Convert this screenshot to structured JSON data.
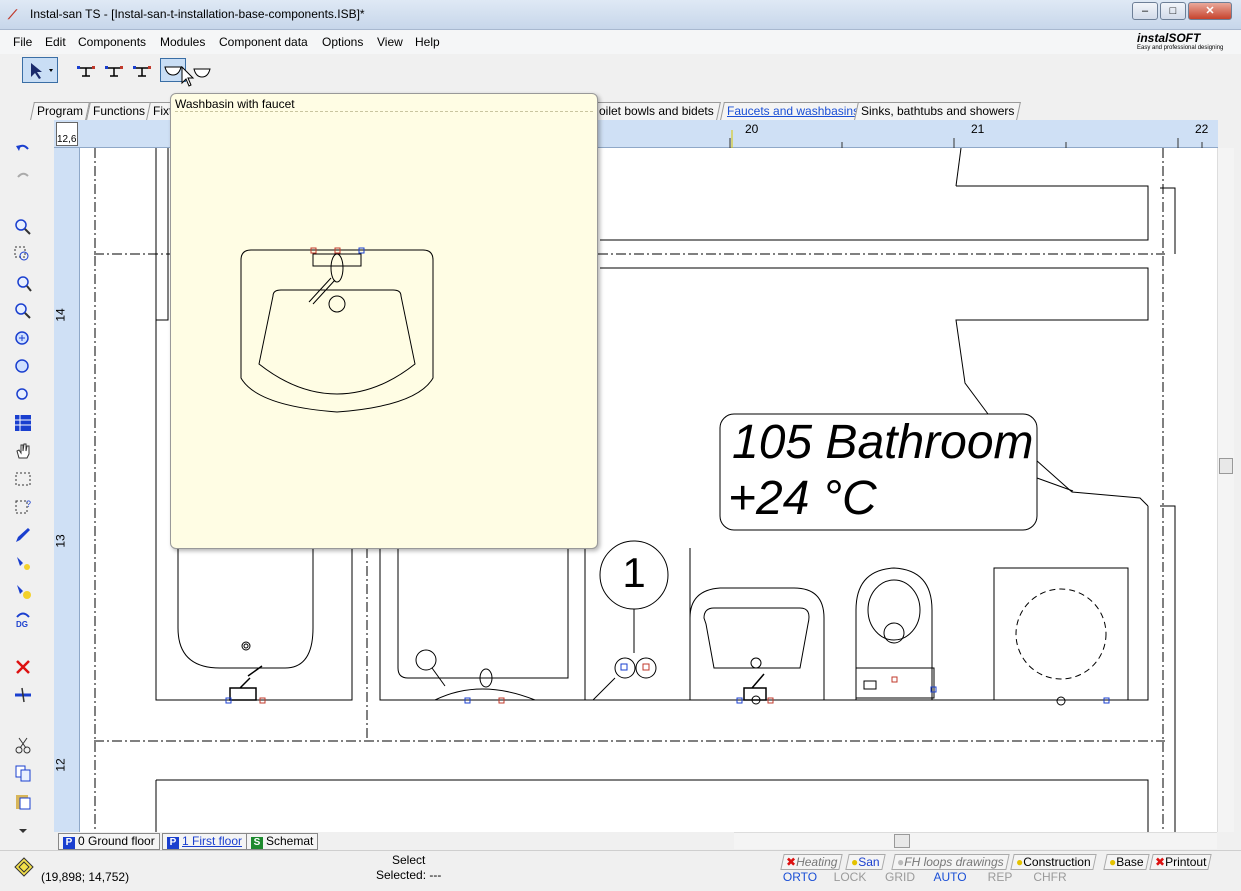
{
  "window": {
    "title": "Instal-san TS - [Instal-san-t-installation-base-components.ISB]*",
    "buttons": [
      "–",
      "□",
      "✕"
    ]
  },
  "menu": [
    "File",
    "Edit",
    "Components",
    "Modules",
    "Component data",
    "Options",
    "View",
    "Help"
  ],
  "logo": {
    "brand": "instalSOFT",
    "tagline": "Easy and professional designing"
  },
  "component_tabs": [
    "Program",
    "Functions",
    "Fixt",
    "oilet bowls and bidets",
    "Faucets and washbasins",
    "Sinks, bathtubs and showers"
  ],
  "active_component_tab": "Faucets and washbasins",
  "tooltip": {
    "title": "Washbasin with faucet"
  },
  "ruler": {
    "corner": "12,6",
    "h_labels": [
      "20",
      "21",
      "22"
    ],
    "v_labels": [
      "14",
      "13",
      "12"
    ]
  },
  "drawing": {
    "room_name": "105 Bathroom",
    "room_temp": "+24 °C",
    "marker": "1"
  },
  "floor_tabs": [
    {
      "badge": "P",
      "label": "0 Ground floor",
      "color": "#1a3fcf"
    },
    {
      "badge": "P",
      "label": "1 First floor",
      "color": "#1a3fcf"
    },
    {
      "badge": "S",
      "label": "Schemat",
      "color": "#1d8a2e"
    }
  ],
  "status": {
    "coords": "(19,898; 14,752)",
    "mode": "Select",
    "selected": "Selected: ---"
  },
  "layers": [
    "Heating",
    "San",
    "FH loops drawings",
    "Construction",
    "Base",
    "Printout"
  ],
  "modes": [
    {
      "label": "ORTO",
      "on": true
    },
    {
      "label": "LOCK",
      "on": false
    },
    {
      "label": "GRID",
      "on": false
    },
    {
      "label": "AUTO",
      "on": true
    },
    {
      "label": "REP",
      "on": false
    },
    {
      "label": "CHFR",
      "on": false
    }
  ]
}
